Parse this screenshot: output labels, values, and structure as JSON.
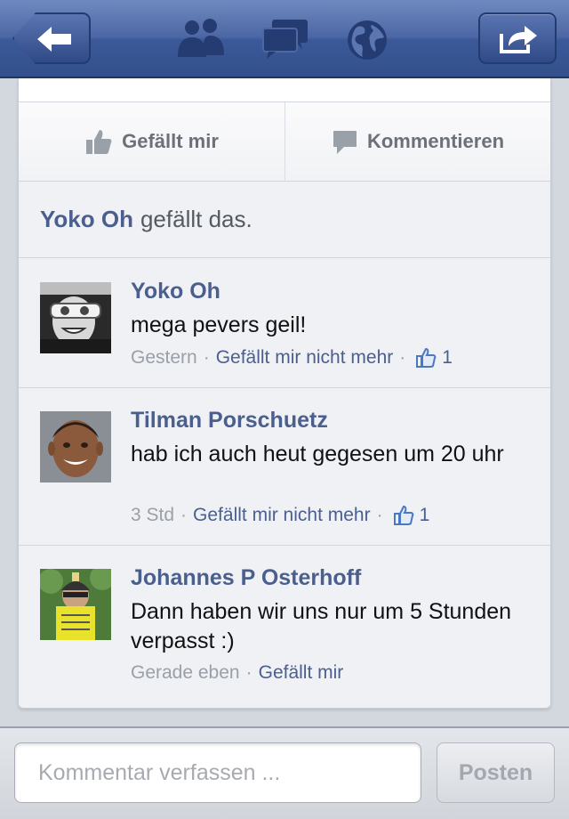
{
  "navbar": {
    "back_icon": "back-arrow-icon",
    "share_icon": "share-icon",
    "icons": [
      "friends-icon",
      "messages-icon",
      "globe-icon"
    ]
  },
  "actions": {
    "like_label": "Gefällt mir",
    "comment_label": "Kommentieren"
  },
  "likes": {
    "name": "Yoko Oh",
    "suffix": "gefällt das."
  },
  "comments": [
    {
      "name": "Yoko Oh",
      "text": "mega pevers geil!",
      "time": "Gestern",
      "like_action": "Gefällt mir nicht mehr",
      "like_count": "1"
    },
    {
      "name": "Tilman Porschuetz",
      "text": "hab ich auch heut gegesen um 20 uhr",
      "time": "3 Std",
      "like_action": "Gefällt mir nicht mehr",
      "like_count": "1"
    },
    {
      "name": "Johannes P Osterhoff",
      "text": "Dann haben wir uns nur um 5 Stunden verpasst :)",
      "time": "Gerade eben",
      "like_action": "Gefällt mir"
    }
  ],
  "composer": {
    "placeholder": "Kommentar verfassen ...",
    "value": "",
    "post_label": "Posten"
  },
  "colors": {
    "nav_blue": "#3b5998",
    "link_blue": "#4b5f8f",
    "meta_gray": "#9aa0a8"
  }
}
